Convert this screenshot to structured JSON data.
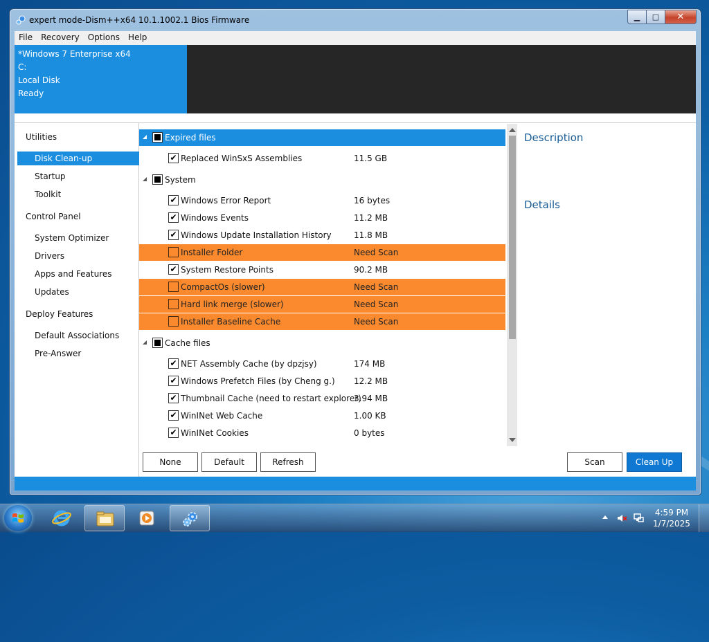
{
  "window": {
    "title": "expert mode-Dism++x64 10.1.1002.1 Bios Firmware",
    "controls": {
      "minimize": "▁",
      "maximize": "□",
      "close": "✕"
    }
  },
  "menu": [
    "File",
    "Recovery",
    "Options",
    "Help"
  ],
  "info": {
    "os": "*Windows 7 Enterprise x64",
    "drive": "C:",
    "disk": "Local Disk",
    "status": "Ready"
  },
  "sidebar": {
    "groups": [
      {
        "label": "Utilities",
        "items": [
          "Disk Clean-up",
          "Startup",
          "Toolkit"
        ]
      },
      {
        "label": "Control Panel",
        "items": [
          "System Optimizer",
          "Drivers",
          "Apps and Features",
          "Updates"
        ]
      },
      {
        "label": "Deploy Features",
        "items": [
          "Default Associations",
          "Pre-Answer"
        ]
      }
    ],
    "selected": "Disk Clean-up"
  },
  "cleanup": {
    "groups": [
      {
        "label": "Expired files",
        "items": [
          {
            "label": "Replaced WinSxS Assemblies",
            "value": "11.5 GB",
            "checked": true,
            "status": "normal"
          }
        ]
      },
      {
        "label": "System",
        "items": [
          {
            "label": "Windows Error Report",
            "value": "16 bytes",
            "checked": true,
            "status": "normal"
          },
          {
            "label": "Windows Events",
            "value": "11.2 MB",
            "checked": true,
            "status": "normal"
          },
          {
            "label": "Windows Update Installation History",
            "value": "11.8 MB",
            "checked": true,
            "status": "normal"
          },
          {
            "label": "Installer Folder",
            "value": "Need Scan",
            "checked": false,
            "status": "warn"
          },
          {
            "label": "System Restore Points",
            "value": "90.2 MB",
            "checked": true,
            "status": "normal"
          },
          {
            "label": "CompactOs (slower)",
            "value": "Need Scan",
            "checked": false,
            "status": "warn"
          },
          {
            "label": "Hard link merge (slower)",
            "value": "Need Scan",
            "checked": false,
            "status": "warn"
          },
          {
            "label": "Installer Baseline Cache",
            "value": "Need Scan",
            "checked": false,
            "status": "warn"
          }
        ]
      },
      {
        "label": "Cache files",
        "items": [
          {
            "label": "NET Assembly Cache (by dpzjsy)",
            "value": "174 MB",
            "checked": true,
            "status": "normal"
          },
          {
            "label": "Windows Prefetch Files (by Cheng g.)",
            "value": "12.2 MB",
            "checked": true,
            "status": "normal"
          },
          {
            "label": "Thumbnail Cache (need to restart explorer)",
            "value": "3.94 MB",
            "checked": true,
            "status": "normal"
          },
          {
            "label": "WinINet Web Cache",
            "value": "1.00 KB",
            "checked": true,
            "status": "normal"
          },
          {
            "label": "WinINet Cookies",
            "value": "0 bytes",
            "checked": true,
            "status": "normal"
          }
        ]
      }
    ],
    "selected_group": "Expired files"
  },
  "right_pane": {
    "description": "Description",
    "details": "Details"
  },
  "buttons": {
    "none": "None",
    "default": "Default",
    "refresh": "Refresh",
    "scan": "Scan",
    "clean_up": "Clean Up"
  },
  "taskbar": {
    "apps": [
      "internet-explorer-icon",
      "windows-explorer-icon",
      "media-player-icon",
      "dism-gear-icon"
    ],
    "active_app": "dism-gear-icon",
    "time": "4:59 PM",
    "date": "1/7/2025"
  },
  "colors": {
    "accent": "#1c8ee0",
    "warning": "#fb8a2e",
    "dark": "#262626",
    "primary_button": "#0f78d3"
  }
}
